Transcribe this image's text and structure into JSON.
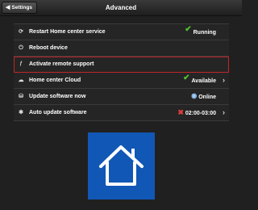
{
  "header": {
    "back_label": "Settings",
    "title": "Advanced"
  },
  "rows": [
    {
      "label": "Restart Home center service",
      "icon": "refresh-icon",
      "status": "Running",
      "status_icon": "checkmark-icon"
    },
    {
      "label": "Reboot device",
      "icon": "power-icon"
    },
    {
      "label": "Activate remote support",
      "icon": "wrench-icon"
    },
    {
      "label": "Home center Cloud",
      "icon": "cloud-icon",
      "status": "Available",
      "status_icon": "checkmark-icon"
    },
    {
      "label": "Update software now",
      "icon": "update-icon",
      "status": "Online",
      "status_icon": "globe-icon"
    },
    {
      "label": "Auto update software",
      "icon": "settings-icon",
      "status": "02:00-03:00",
      "status_icon": "x-icon"
    }
  ],
  "colors": {
    "accent_blue": "#1157b6",
    "highlight_red": "#c0262a",
    "check_green": "#52c234",
    "x_red": "#e03c3c"
  }
}
